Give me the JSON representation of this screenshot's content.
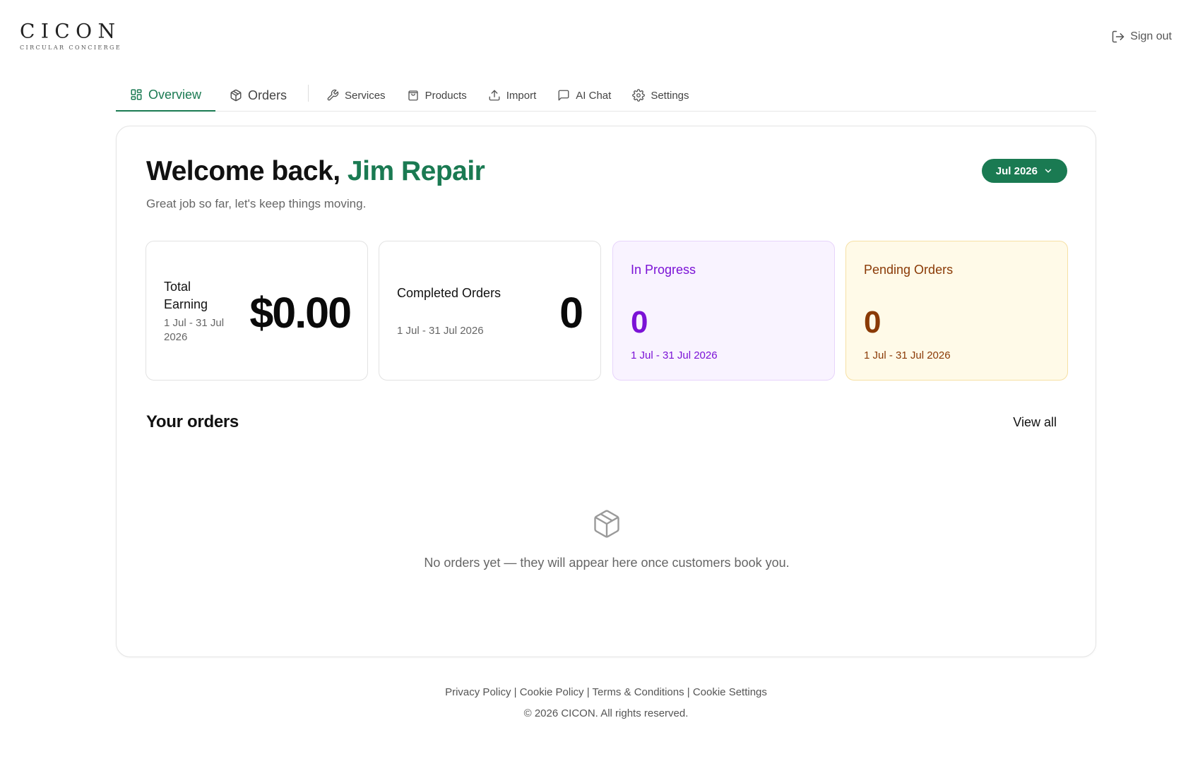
{
  "brand": {
    "logo_word": "CICON",
    "logo_tagline": "CIRCULAR CONCIERGE"
  },
  "header": {
    "sign_out": "Sign out"
  },
  "nav": {
    "overview": "Overview",
    "orders": "Orders",
    "services": "Services",
    "products": "Products",
    "import": "Import",
    "ai_chat": "AI Chat",
    "settings": "Settings"
  },
  "welcome": {
    "prefix": "Welcome back, ",
    "name": "Jim Repair",
    "tagline": "Great job so far, let's keep things moving."
  },
  "period_selector": {
    "value": "Jul 2026"
  },
  "stats": {
    "total_earning": {
      "title": "Total Earning",
      "value": "$0.00",
      "date_range": "1 Jul - 31 Jul 2026"
    },
    "completed_orders": {
      "title": "Completed Orders",
      "value": "0",
      "date_range": "1 Jul - 31 Jul 2026"
    },
    "in_progress": {
      "title": "In Progress",
      "value": "0",
      "date_range": "1 Jul - 31 Jul 2026"
    },
    "pending_orders": {
      "title": "Pending Orders",
      "value": "0",
      "date_range": "1 Jul - 31 Jul 2026"
    }
  },
  "orders_section": {
    "title": "Your orders",
    "view_all": "View all",
    "empty_message": "No orders yet — they will appear here once customers book you."
  },
  "footer": {
    "links": [
      "Privacy Policy",
      "Cookie Policy",
      "Terms & Conditions",
      "Cookie Settings"
    ],
    "separator": " | ",
    "copyright": "© 2026 CICON. All rights reserved."
  },
  "colors": {
    "accent": "#1a7a52",
    "in_progress": "#7b12d6",
    "in_progress_bg": "#f9f3ff",
    "pending": "#8a3a06",
    "pending_bg": "#fffae8"
  },
  "icons": {
    "overview": "grid-icon",
    "orders": "box-icon",
    "services": "wrench-icon",
    "products": "shopping-bag-icon",
    "import": "upload-icon",
    "ai_chat": "chat-icon",
    "settings": "gear-icon",
    "sign_out": "sign-out-icon",
    "empty_orders": "box-icon"
  }
}
